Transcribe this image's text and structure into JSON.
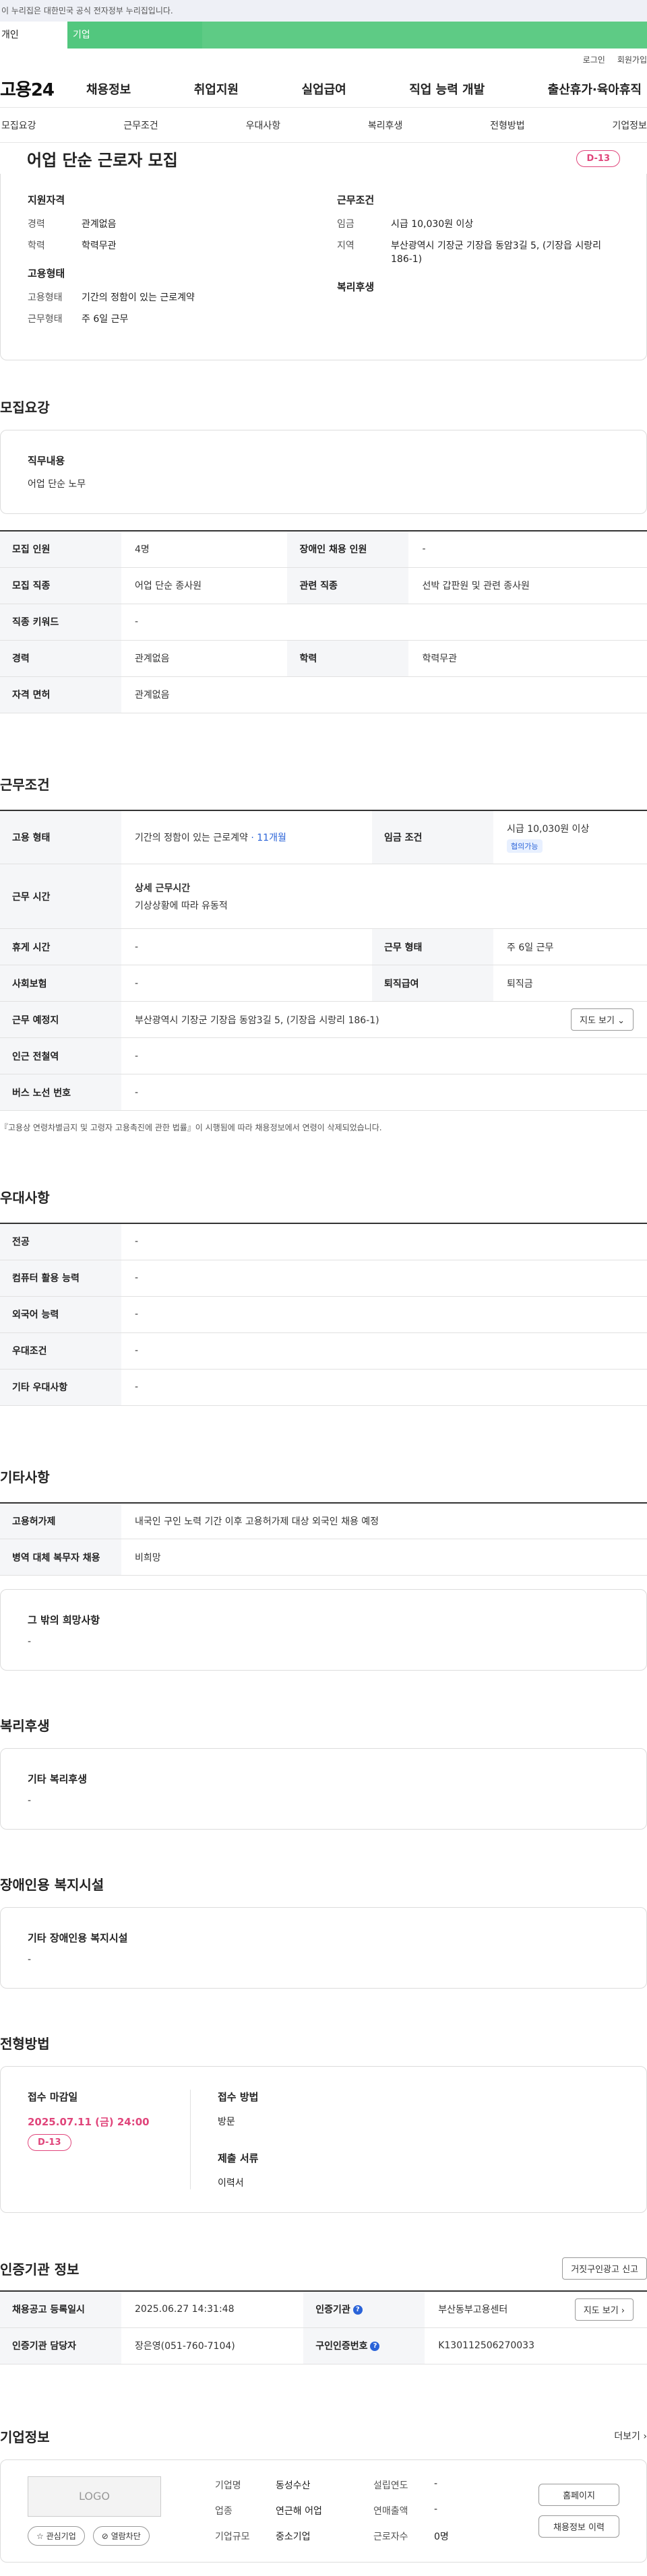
{
  "gov_banner": "이 누리집은 대한민국 공식 전자정부 누리집입니다.",
  "tabs": [
    "개인",
    "기업"
  ],
  "util": [
    "로그인",
    "회원가입"
  ],
  "logo": "고용24",
  "gnb": [
    "채용정보",
    "취업지원",
    "실업급여",
    "직업 능력 개발",
    "출산휴가·육아휴직"
  ],
  "snb": [
    "모집요강",
    "근무조건",
    "우대사항",
    "복리후생",
    "전형방법",
    "기업정보"
  ],
  "job": {
    "title": "어업 단순 근로자 모집",
    "dday": "D-13",
    "qual_title": "지원자격",
    "qual": [
      {
        "k": "경력",
        "v": "관계없음"
      },
      {
        "k": "학력",
        "v": "학력무관"
      }
    ],
    "cond_title": "근무조건",
    "cond": [
      {
        "k": "임금",
        "v": "시급 10,030원 이상"
      },
      {
        "k": "지역",
        "v": "부산광역시 기장군 기장읍 동암3길 5, (기장읍 시랑리 186-1)"
      }
    ],
    "emp_title": "고용형태",
    "emp": [
      {
        "k": "고용형태",
        "v": "기간의 정함이 있는 근로계약"
      },
      {
        "k": "근무형태",
        "v": "주 6일 근무"
      }
    ],
    "welfare_title": "복리후생"
  },
  "recruit": {
    "title": "모집요강",
    "duty_title": "직무내용",
    "duty": "어업 단순 노무",
    "rows": [
      {
        "k1": "모집 인원",
        "v1": "4명",
        "k2": "장애인 채용 인원",
        "v2": "-"
      },
      {
        "k1": "모집 직종",
        "v1": "어업 단순 종사원",
        "k2": "관련 직종",
        "v2": "선박 갑판원 및 관련 종사원"
      },
      {
        "k1": "직종 키워드",
        "v1": "-"
      },
      {
        "k1": "경력",
        "v1": "관계없음",
        "k2": "학력",
        "v2": "학력무관"
      },
      {
        "k1": "자격 면허",
        "v1": "관계없음"
      }
    ]
  },
  "work": {
    "title": "근무조건",
    "emp_type_k": "고용 형태",
    "emp_type_v": "기간의 정함이 있는 근로계약",
    "emp_type_months": " · 11개월",
    "wage_k": "임금 조건",
    "wage_v": "시급 10,030원 이상",
    "wage_badge": "협의가능",
    "hours_k": "근무 시간",
    "hours_sub": "상세 근무시간",
    "hours_v": "기상상황에 따라 유동적",
    "rows": [
      {
        "k1": "휴게 시간",
        "v1": "-",
        "k2": "근무 형태",
        "v2": "주 6일 근무"
      },
      {
        "k1": "사회보험",
        "v1": "-",
        "k2": "퇴직급여",
        "v2": "퇴직금"
      }
    ],
    "place_k": "근무 예정지",
    "place_v": "부산광역시 기장군 기장읍 동암3길 5, (기장읍 시랑리 186-1)",
    "map_btn": "지도 보기 ⌄",
    "rows2": [
      {
        "k1": "인근 전철역",
        "v1": "-"
      },
      {
        "k1": "버스 노선 번호",
        "v1": "-"
      }
    ],
    "note": "『고용상 연령차별금지 및 고령자 고용촉진에 관한 법률』이 시행됨에 따라 채용정보에서 연령이 삭제되었습니다."
  },
  "pref": {
    "title": "우대사항",
    "rows": [
      {
        "k1": "전공",
        "v1": "-"
      },
      {
        "k1": "컴퓨터 활용 능력",
        "v1": "-"
      },
      {
        "k1": "외국어 능력",
        "v1": "-"
      },
      {
        "k1": "우대조건",
        "v1": "-"
      },
      {
        "k1": "기타 우대사항",
        "v1": "-"
      }
    ]
  },
  "etc": {
    "title": "기타사항",
    "rows": [
      {
        "k1": "고용허가제",
        "v1": "내국인 구인 노력 기간 이후 고용허가제 대상 외국인 채용 예정"
      },
      {
        "k1": "병역 대체 복무자 채용",
        "v1": "비희망"
      }
    ],
    "box_title": "그 밖의 희망사항",
    "box_v": "-"
  },
  "welfare": {
    "title": "복리후생",
    "box_title": "기타 복리후생",
    "box_v": "-"
  },
  "disabled": {
    "title": "장애인용 복지시설",
    "box_title": "기타 장애인용 복지시설",
    "box_v": "-"
  },
  "process": {
    "title": "전형방법",
    "deadline_title": "접수 마감일",
    "deadline": "2025.07.11 (금) 24:00",
    "dday": "D-13",
    "method_title": "접수 방법",
    "method": "방문",
    "docs_title": "제출 서류",
    "docs": "이력서"
  },
  "cert": {
    "title": "인증기관 정보",
    "report_btn": "거짓구인광고 신고",
    "reg_k": "채용공고 등록일시",
    "reg_v": "2025.06.27 14:31:48",
    "org_k": "인증기관",
    "org_v": "부산동부고용센터",
    "map_btn": "지도 보기 ›",
    "mgr_k": "인증기관 담당자",
    "mgr_v": "장은영(051-760-7104)",
    "no_k": "구인인증번호",
    "no_v": "K130112506270033"
  },
  "company": {
    "title": "기업정보",
    "more": "더보기 ›",
    "logo_text": "LOGO",
    "fav_btn": "☆ 관심기업",
    "block_btn": "⊘ 열람차단",
    "info": [
      {
        "k": "기업명",
        "v": "동성수산"
      },
      {
        "k": "설립연도",
        "v": "-"
      },
      {
        "k": "업종",
        "v": "연근해 어업"
      },
      {
        "k": "연매출액",
        "v": "-"
      },
      {
        "k": "기업규모",
        "v": "중소기업"
      },
      {
        "k": "근로자수",
        "v": "0명"
      }
    ],
    "home_btn": "홈페이지",
    "history_btn": "채용정보 이력"
  },
  "colors": {
    "accent_green": "#52c77e",
    "dday_pink": "#e0457b",
    "link_blue": "#2a63d8"
  }
}
